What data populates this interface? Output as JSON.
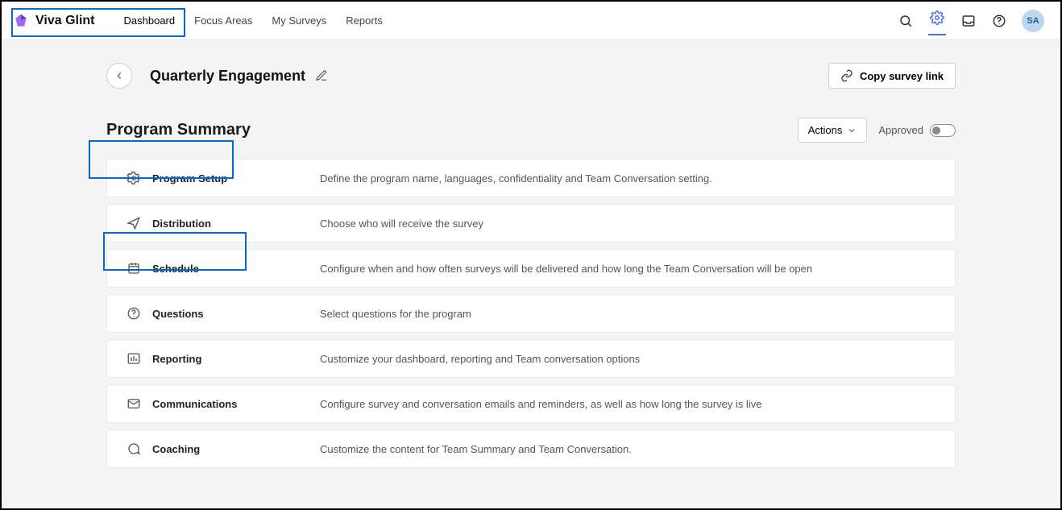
{
  "brand": {
    "name": "Viva Glint"
  },
  "nav": {
    "items": [
      "Dashboard",
      "Focus Areas",
      "My Surveys",
      "Reports"
    ],
    "active_index": 0
  },
  "user": {
    "initials": "SA"
  },
  "page": {
    "title": "Quarterly Engagement",
    "copy_button": "Copy survey link"
  },
  "section": {
    "title": "Program Summary",
    "actions_label": "Actions",
    "approved_label": "Approved",
    "approved_on": false
  },
  "rows": [
    {
      "icon": "gear",
      "title": "Program Setup",
      "desc": "Define the program name, languages, confidentiality and Team Conversation setting."
    },
    {
      "icon": "send",
      "title": "Distribution",
      "desc": "Choose who will receive the survey"
    },
    {
      "icon": "calendar",
      "title": "Schedule",
      "desc": "Configure when and how often surveys will be delivered and how long the Team Conversation will be open"
    },
    {
      "icon": "help",
      "title": "Questions",
      "desc": "Select questions for the program"
    },
    {
      "icon": "chart",
      "title": "Reporting",
      "desc": "Customize your dashboard, reporting and Team conversation options"
    },
    {
      "icon": "mail",
      "title": "Communications",
      "desc": "Configure survey and conversation emails and reminders, as well as how long the survey is live"
    },
    {
      "icon": "chat",
      "title": "Coaching",
      "desc": "Customize the content for Team Summary and Team Conversation."
    }
  ]
}
